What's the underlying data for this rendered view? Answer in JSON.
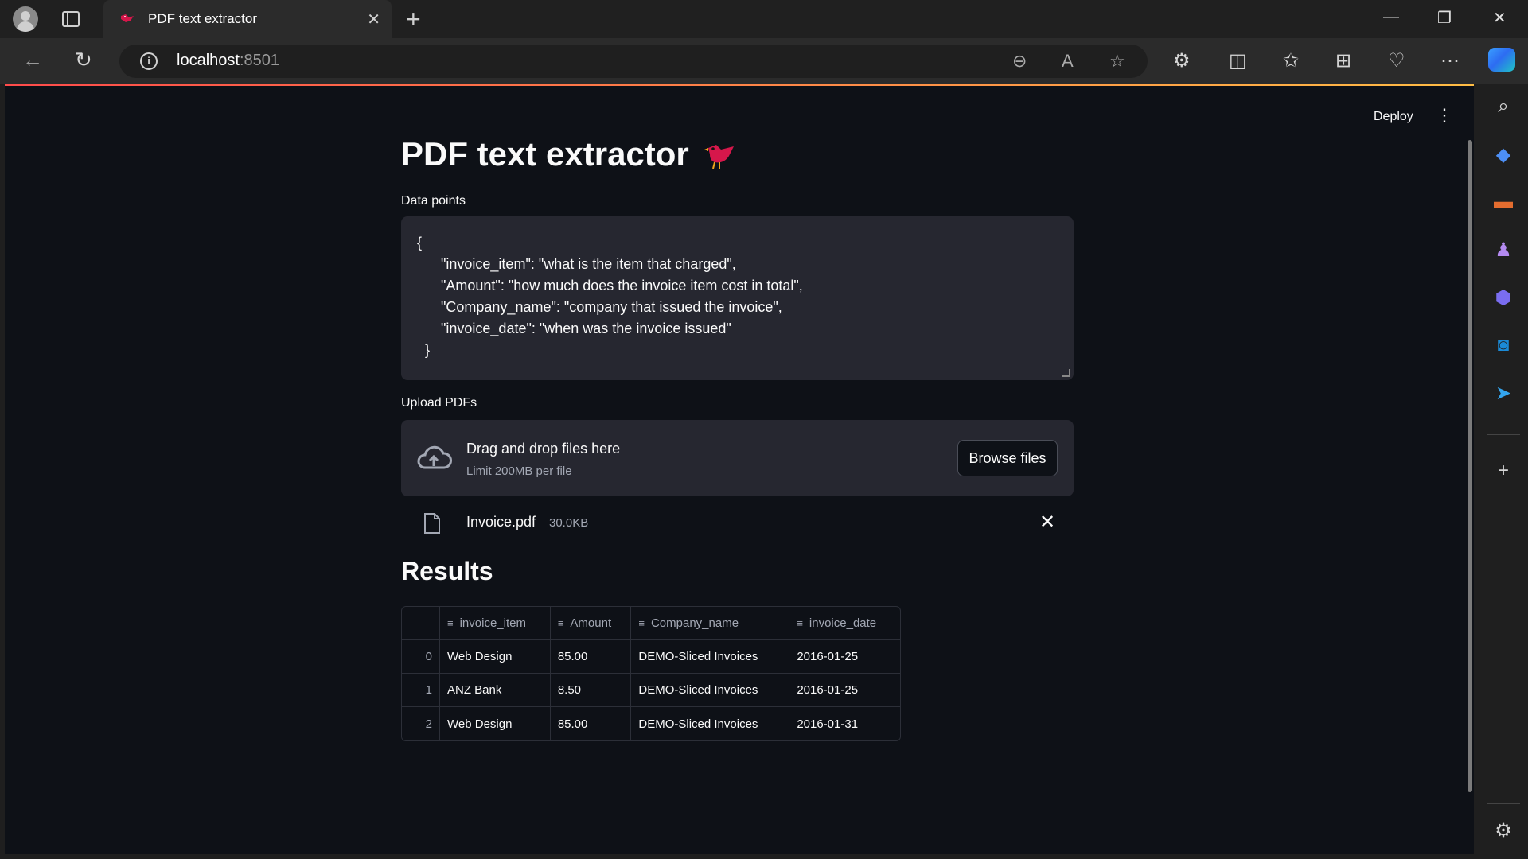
{
  "browser": {
    "tab_title": "PDF text extractor",
    "tab_close": "✕",
    "new_tab": "+",
    "url_host": "localhost",
    "url_port": ":8501",
    "window_controls": [
      "minimize-icon",
      "restore-icon",
      "close-icon"
    ]
  },
  "app": {
    "deploy_label": "Deploy",
    "menu_label": "⋮",
    "title": "PDF text extractor",
    "data_points_label": "Data points",
    "data_points_value": "{\n      \"invoice_item\": \"what is the item that charged\",\n      \"Amount\": \"how much does the invoice item cost in total\",\n      \"Company_name\": \"company that issued the invoice\",\n      \"invoice_date\": \"when was the invoice issued\"\n  }",
    "upload_label": "Upload PDFs",
    "drop_main": "Drag and drop files here",
    "drop_sub": "Limit 200MB per file",
    "browse_label": "Browse files",
    "file_name": "Invoice.pdf",
    "file_size": "30.0KB",
    "results_title": "Results",
    "table": {
      "columns": [
        "invoice_item",
        "Amount",
        "Company_name",
        "invoice_date"
      ],
      "rows": [
        {
          "index": "0",
          "cells": [
            "Web Design",
            "85.00",
            "DEMO-Sliced Invoices",
            "2016-01-25"
          ]
        },
        {
          "index": "1",
          "cells": [
            "ANZ Bank",
            "8.50",
            "DEMO-Sliced Invoices",
            "2016-01-25"
          ]
        },
        {
          "index": "2",
          "cells": [
            "Web Design",
            "85.00",
            "DEMO-Sliced Invoices",
            "2016-01-31"
          ]
        }
      ]
    }
  },
  "colors": {
    "page_bg": "#0e1117",
    "widget_bg": "#262730",
    "accent": "#ff4b4b",
    "bird": "#d6174b"
  }
}
